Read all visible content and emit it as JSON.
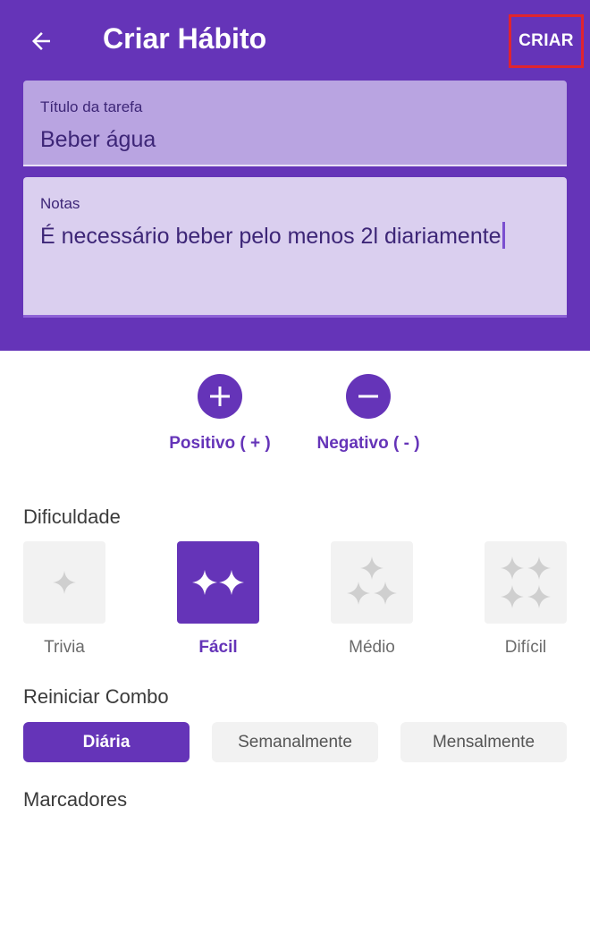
{
  "header": {
    "title": "Criar Hábito",
    "create_label": "CRIAR",
    "color": "#6534b8"
  },
  "form": {
    "title_label": "Título da tarefa",
    "title_value": "Beber água",
    "notes_label": "Notas",
    "notes_value": "É necessário beber pelo menos 2l diariamente"
  },
  "scoring": {
    "positive_label": "Positivo ( + )",
    "negative_label": "Negativo ( - )"
  },
  "difficulty": {
    "title": "Dificuldade",
    "options": [
      {
        "label": "Trivia",
        "icon": "sparkle-1-icon",
        "selected": false
      },
      {
        "label": "Fácil",
        "icon": "sparkle-2-icon",
        "selected": true
      },
      {
        "label": "Médio",
        "icon": "sparkle-3-icon",
        "selected": false
      },
      {
        "label": "Difícil",
        "icon": "sparkle-4-icon",
        "selected": false
      }
    ]
  },
  "combo": {
    "title": "Reiniciar Combo",
    "options": [
      {
        "label": "Diária",
        "selected": true
      },
      {
        "label": "Semanalmente",
        "selected": false
      },
      {
        "label": "Mensalmente",
        "selected": false
      }
    ]
  },
  "tags": {
    "title": "Marcadores"
  }
}
